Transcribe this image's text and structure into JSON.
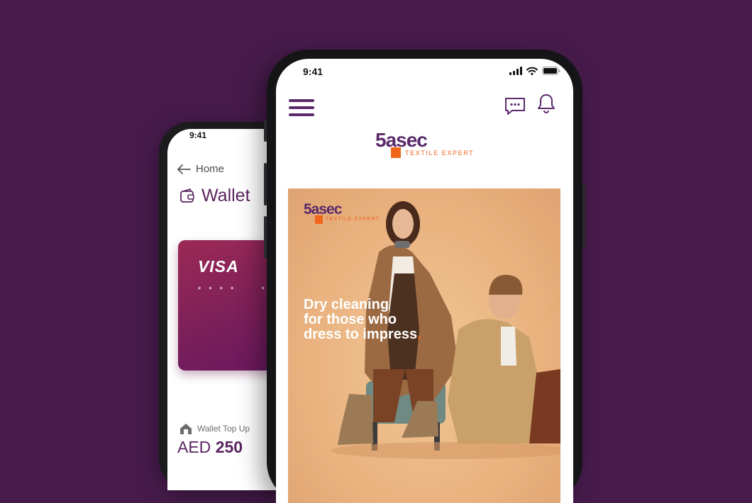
{
  "wallet_screen": {
    "status_time": "9:41",
    "back_label": "Home",
    "title": "Wallet",
    "card": {
      "brand": "VISA",
      "masked_number": "* * * *     *"
    },
    "topup_label": "Wallet Top Up",
    "currency": "AED",
    "amount": "250"
  },
  "home_screen": {
    "status_time": "9:41",
    "brand_name": "5asec",
    "brand_tagline": "TEXTILE EXPERT",
    "banner": {
      "brand_name": "5asec",
      "brand_tagline": "TEXTILE EXPERT",
      "headline_line1": "Dry cleaning",
      "headline_line2": "for those who",
      "headline_line3": "dress to impress",
      "headline_dot": "."
    }
  },
  "colors": {
    "background": "#461b4b",
    "brand_purple": "#5a2a6a",
    "brand_orange": "#f06418",
    "card_start": "#9b2a55",
    "card_end": "#64175e"
  }
}
